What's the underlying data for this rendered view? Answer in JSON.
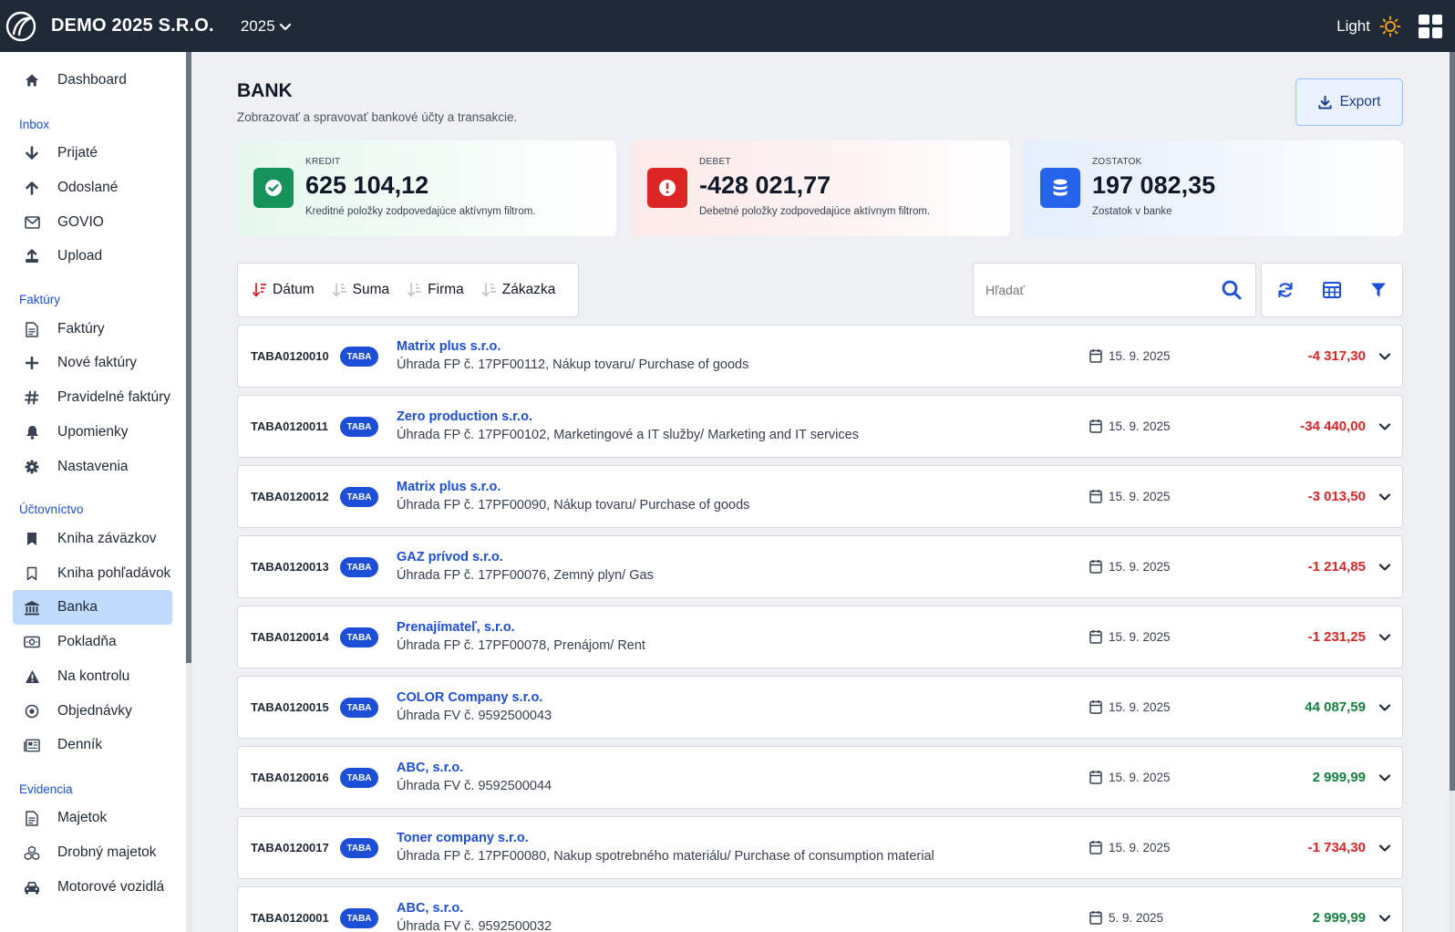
{
  "header": {
    "company": "DEMO 2025 S.R.O.",
    "year": "2025",
    "theme_label": "Light"
  },
  "sidebar": {
    "items": [
      {
        "label": "Dashboard",
        "icon": "home-icon"
      },
      {
        "section": "Inbox"
      },
      {
        "label": "Prijaté",
        "icon": "arrow-down-icon"
      },
      {
        "label": "Odoslané",
        "icon": "arrow-up-icon"
      },
      {
        "label": "GOVIO",
        "icon": "envelope-icon"
      },
      {
        "label": "Upload",
        "icon": "upload-icon"
      },
      {
        "section": "Faktúry"
      },
      {
        "label": "Faktúry",
        "icon": "document-icon"
      },
      {
        "label": "Nové faktúry",
        "icon": "plus-icon"
      },
      {
        "label": "Pravidelné faktúry",
        "icon": "hash-icon"
      },
      {
        "label": "Upomienky",
        "icon": "bell-icon"
      },
      {
        "label": "Nastavenia",
        "icon": "gear-icon"
      },
      {
        "section": "Účtovníctvo"
      },
      {
        "label": "Kniha záväzkov",
        "icon": "bookmark-filled-icon"
      },
      {
        "label": "Kniha pohľadávok",
        "icon": "bookmark-outline-icon"
      },
      {
        "label": "Banka",
        "icon": "bank-icon",
        "active": true
      },
      {
        "label": "Pokladňa",
        "icon": "cash-icon"
      },
      {
        "label": "Na kontrolu",
        "icon": "warning-icon"
      },
      {
        "label": "Objednávky",
        "icon": "target-icon"
      },
      {
        "label": "Denník",
        "icon": "newspaper-icon"
      },
      {
        "section": "Evidencia"
      },
      {
        "label": "Majetok",
        "icon": "document-icon"
      },
      {
        "label": "Drobný majetok",
        "icon": "boxes-icon"
      },
      {
        "label": "Motorové vozidlá",
        "icon": "car-icon"
      }
    ]
  },
  "page": {
    "title": "BANK",
    "subtitle": "Zobrazovať a spravovať bankové účty a transakcie.",
    "export_label": "Export"
  },
  "cards": {
    "credit": {
      "label": "KREDIT",
      "value": "625 104,12",
      "desc": "Kreditné položky zodpovedajúce aktívnym filtrom.",
      "color": "#16a34a"
    },
    "debit": {
      "label": "DEBET",
      "value": "-428 021,77",
      "desc": "Debetné položky zodpovedajúce aktívnym filtrom.",
      "color": "#dc2626"
    },
    "balance": {
      "label": "ZOSTATOK",
      "value": "197 082,35",
      "desc": "Zostatok v banke",
      "color": "#2563eb"
    }
  },
  "sort": {
    "date": "Dátum",
    "amount": "Suma",
    "firm": "Firma",
    "order": "Zákazka"
  },
  "search": {
    "placeholder": "Hľadať",
    "value": ""
  },
  "transactions": [
    {
      "id": "TABA0120010",
      "badge": "TABA",
      "firm": "Matrix plus s.r.o.",
      "desc": "Úhrada FP č. 17PF00112, Nákup tovaru/ Purchase of goods",
      "date": "15. 9. 2025",
      "amount": "-4 317,30",
      "sign": "neg"
    },
    {
      "id": "TABA0120011",
      "badge": "TABA",
      "firm": "Zero production s.r.o.",
      "desc": "Úhrada FP č. 17PF00102, Marketingové a IT služby/ Marketing and IT services",
      "date": "15. 9. 2025",
      "amount": "-34 440,00",
      "sign": "neg"
    },
    {
      "id": "TABA0120012",
      "badge": "TABA",
      "firm": "Matrix plus s.r.o.",
      "desc": "Úhrada FP č. 17PF00090, Nákup tovaru/ Purchase of goods",
      "date": "15. 9. 2025",
      "amount": "-3 013,50",
      "sign": "neg"
    },
    {
      "id": "TABA0120013",
      "badge": "TABA",
      "firm": "GAZ prívod s.r.o.",
      "desc": "Úhrada FP č. 17PF00076, Zemný plyn/ Gas",
      "date": "15. 9. 2025",
      "amount": "-1 214,85",
      "sign": "neg"
    },
    {
      "id": "TABA0120014",
      "badge": "TABA",
      "firm": "Prenajímateľ, s.r.o.",
      "desc": "Úhrada FP č. 17PF00078, Prenájom/ Rent",
      "date": "15. 9. 2025",
      "amount": "-1 231,25",
      "sign": "neg"
    },
    {
      "id": "TABA0120015",
      "badge": "TABA",
      "firm": "COLOR Company s.r.o.",
      "desc": "Úhrada FV č. 9592500043",
      "date": "15. 9. 2025",
      "amount": "44 087,59",
      "sign": "pos"
    },
    {
      "id": "TABA0120016",
      "badge": "TABA",
      "firm": "ABC, s.r.o.",
      "desc": "Úhrada FV č. 9592500044",
      "date": "15. 9. 2025",
      "amount": "2 999,99",
      "sign": "pos"
    },
    {
      "id": "TABA0120017",
      "badge": "TABA",
      "firm": "Toner company s.r.o.",
      "desc": "Úhrada FP č. 17PF00080, Nakup spotrebného materiálu/ Purchase of consumption material",
      "date": "15. 9. 2025",
      "amount": "-1 734,30",
      "sign": "neg"
    },
    {
      "id": "TABA0120001",
      "badge": "TABA",
      "firm": "ABC, s.r.o.",
      "desc": "Úhrada FV č. 9592500032",
      "date": "5. 9. 2025",
      "amount": "2 999,99",
      "sign": "pos"
    }
  ]
}
